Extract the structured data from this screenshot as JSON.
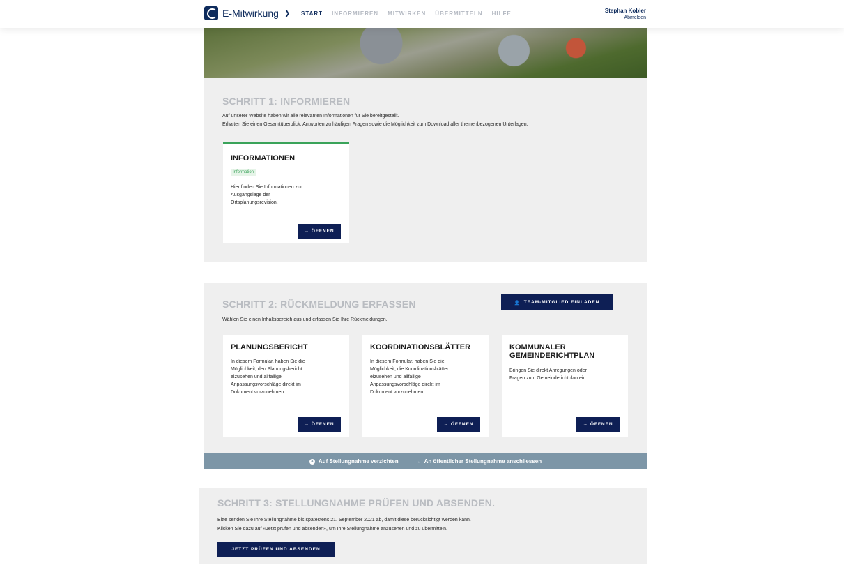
{
  "header": {
    "brand": "E-Mitwirkung",
    "nav": [
      "START",
      "INFORMIEREN",
      "MITWIRKEN",
      "ÜBERMITTELN",
      "HILFE"
    ],
    "user_name": "Stephan Kobler",
    "logout": "Abmelden"
  },
  "step1": {
    "title": "SCHRITT 1: INFORMIEREN",
    "text1": "Auf unserer Website haben wir alle relevanten Informationen für Sie bereitgestellt.",
    "text2": "Erhalten Sie einen Gesamtüberblick, Antworten zu häufigen Fragen sowie die Möglichkeit zum Download aller themenbezogenen Unterlagen.",
    "card": {
      "title": "INFORMATIONEN",
      "tag": "Information",
      "desc": [
        "Hier finden Sie Informationen zur",
        "Ausgangslage der",
        "Ortsplanungsrevision."
      ],
      "button": "ÖFFNEN"
    }
  },
  "step2": {
    "title": "SCHRITT 2: RÜCKMELDUNG ERFASSEN",
    "team_button": "TEAM-MITGLIED EINLADEN",
    "text": "Wählen Sie einen Inhaltsbereich aus und erfassen Sie Ihre Rückmeldungen.",
    "cards": [
      {
        "title": "PLANUNGSBERICHT",
        "desc": [
          "In diesem Formular, haben Sie die",
          "Möglichkeit, den Planungsbericht",
          "eizusehen und allfällige",
          "Anpassungsvorschläge direkt im",
          "Dokument vorzunehmen."
        ],
        "button": "ÖFFNEN"
      },
      {
        "title": "KOORDINATIONSBLÄTTER",
        "desc": [
          "In diesem Formular, haben Sie die",
          "Möglichkeit, die Koordinationsblätter",
          "eizusehen und allfällige",
          "Anpassungsvorschläge direkt im",
          "Dokument vorzunehmen."
        ],
        "button": "ÖFFNEN"
      },
      {
        "title_line1": "KOMMUNALER",
        "title_line2": "GEMEINDERICHTPLAN",
        "desc": [
          "Bringen Sie direkt Anregungen oder",
          "Fragen zum Gemeinderichtplan ein."
        ],
        "button": "ÖFFNEN"
      }
    ],
    "action_decline": "Auf Stellungnahme verzichten",
    "action_join": "An öffentlicher Stellungnahme anschliessen"
  },
  "step3": {
    "title": "SCHRITT 3: STELLUNGNAHME PRÜFEN UND ABSENDEN.",
    "text1": "Bitte senden Sie Ihre Stellungnahme bis spätestens 21. September 2021 ab, damit diese berücksichtigt werden kann.",
    "text2": "Klicken Sie dazu auf «Jetzt prüfen und absenden», um Ihre Stellungnahme anzusehen und zu übermitteln.",
    "button": "JETZT PRÜFEN UND ABSENDEN"
  },
  "colors": {
    "primary": "#0e1f55",
    "accent_green": "#3aa35a",
    "action_bar": "#7d96a7",
    "section_bg": "#efefef"
  },
  "icons": [
    "logo-icon",
    "chevron-down-icon",
    "arrow-right-icon",
    "add-user-icon",
    "close-circle-icon"
  ]
}
